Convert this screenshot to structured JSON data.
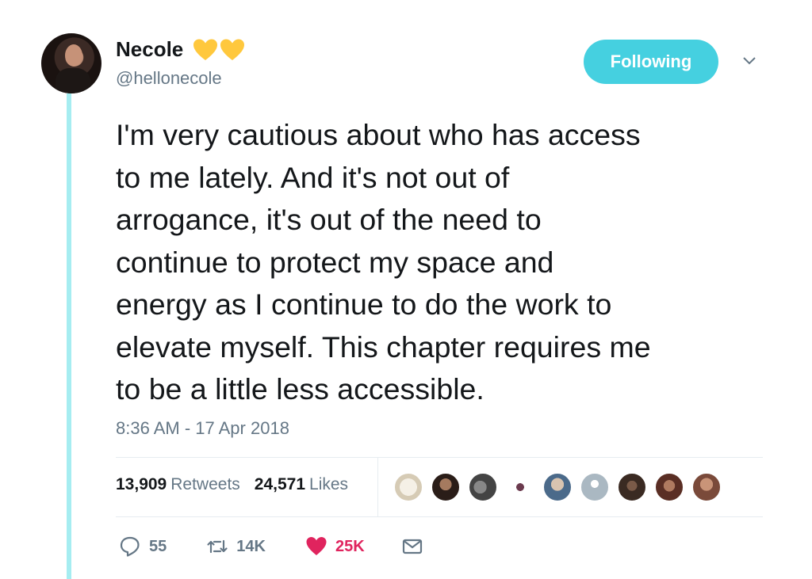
{
  "user": {
    "display_name": "Necole",
    "handle": "@hellonecole"
  },
  "follow_button": {
    "label": "Following"
  },
  "tweet": {
    "lines": [
      "I'm very cautious about who has access",
      "to me lately. And it's not out of",
      "arrogance, it's out of the need to",
      "continue to protect my space and",
      "energy as I continue to do the work to",
      "elevate myself. This chapter requires me",
      "to be a little less accessible."
    ],
    "timestamp": "8:36 AM - 17 Apr 2018"
  },
  "stats": {
    "retweets_count": "13,909",
    "retweets_label": "Retweets",
    "likes_count": "24,571",
    "likes_label": "Likes"
  },
  "actions": {
    "reply_count": "55",
    "retweet_count": "14K",
    "like_count": "25K"
  },
  "colors": {
    "accent": "#45d0e0",
    "thread_line": "#a6edf1",
    "like_red": "#e0245e",
    "heart_yellow": "#ffc83d",
    "secondary_text": "#657786"
  }
}
